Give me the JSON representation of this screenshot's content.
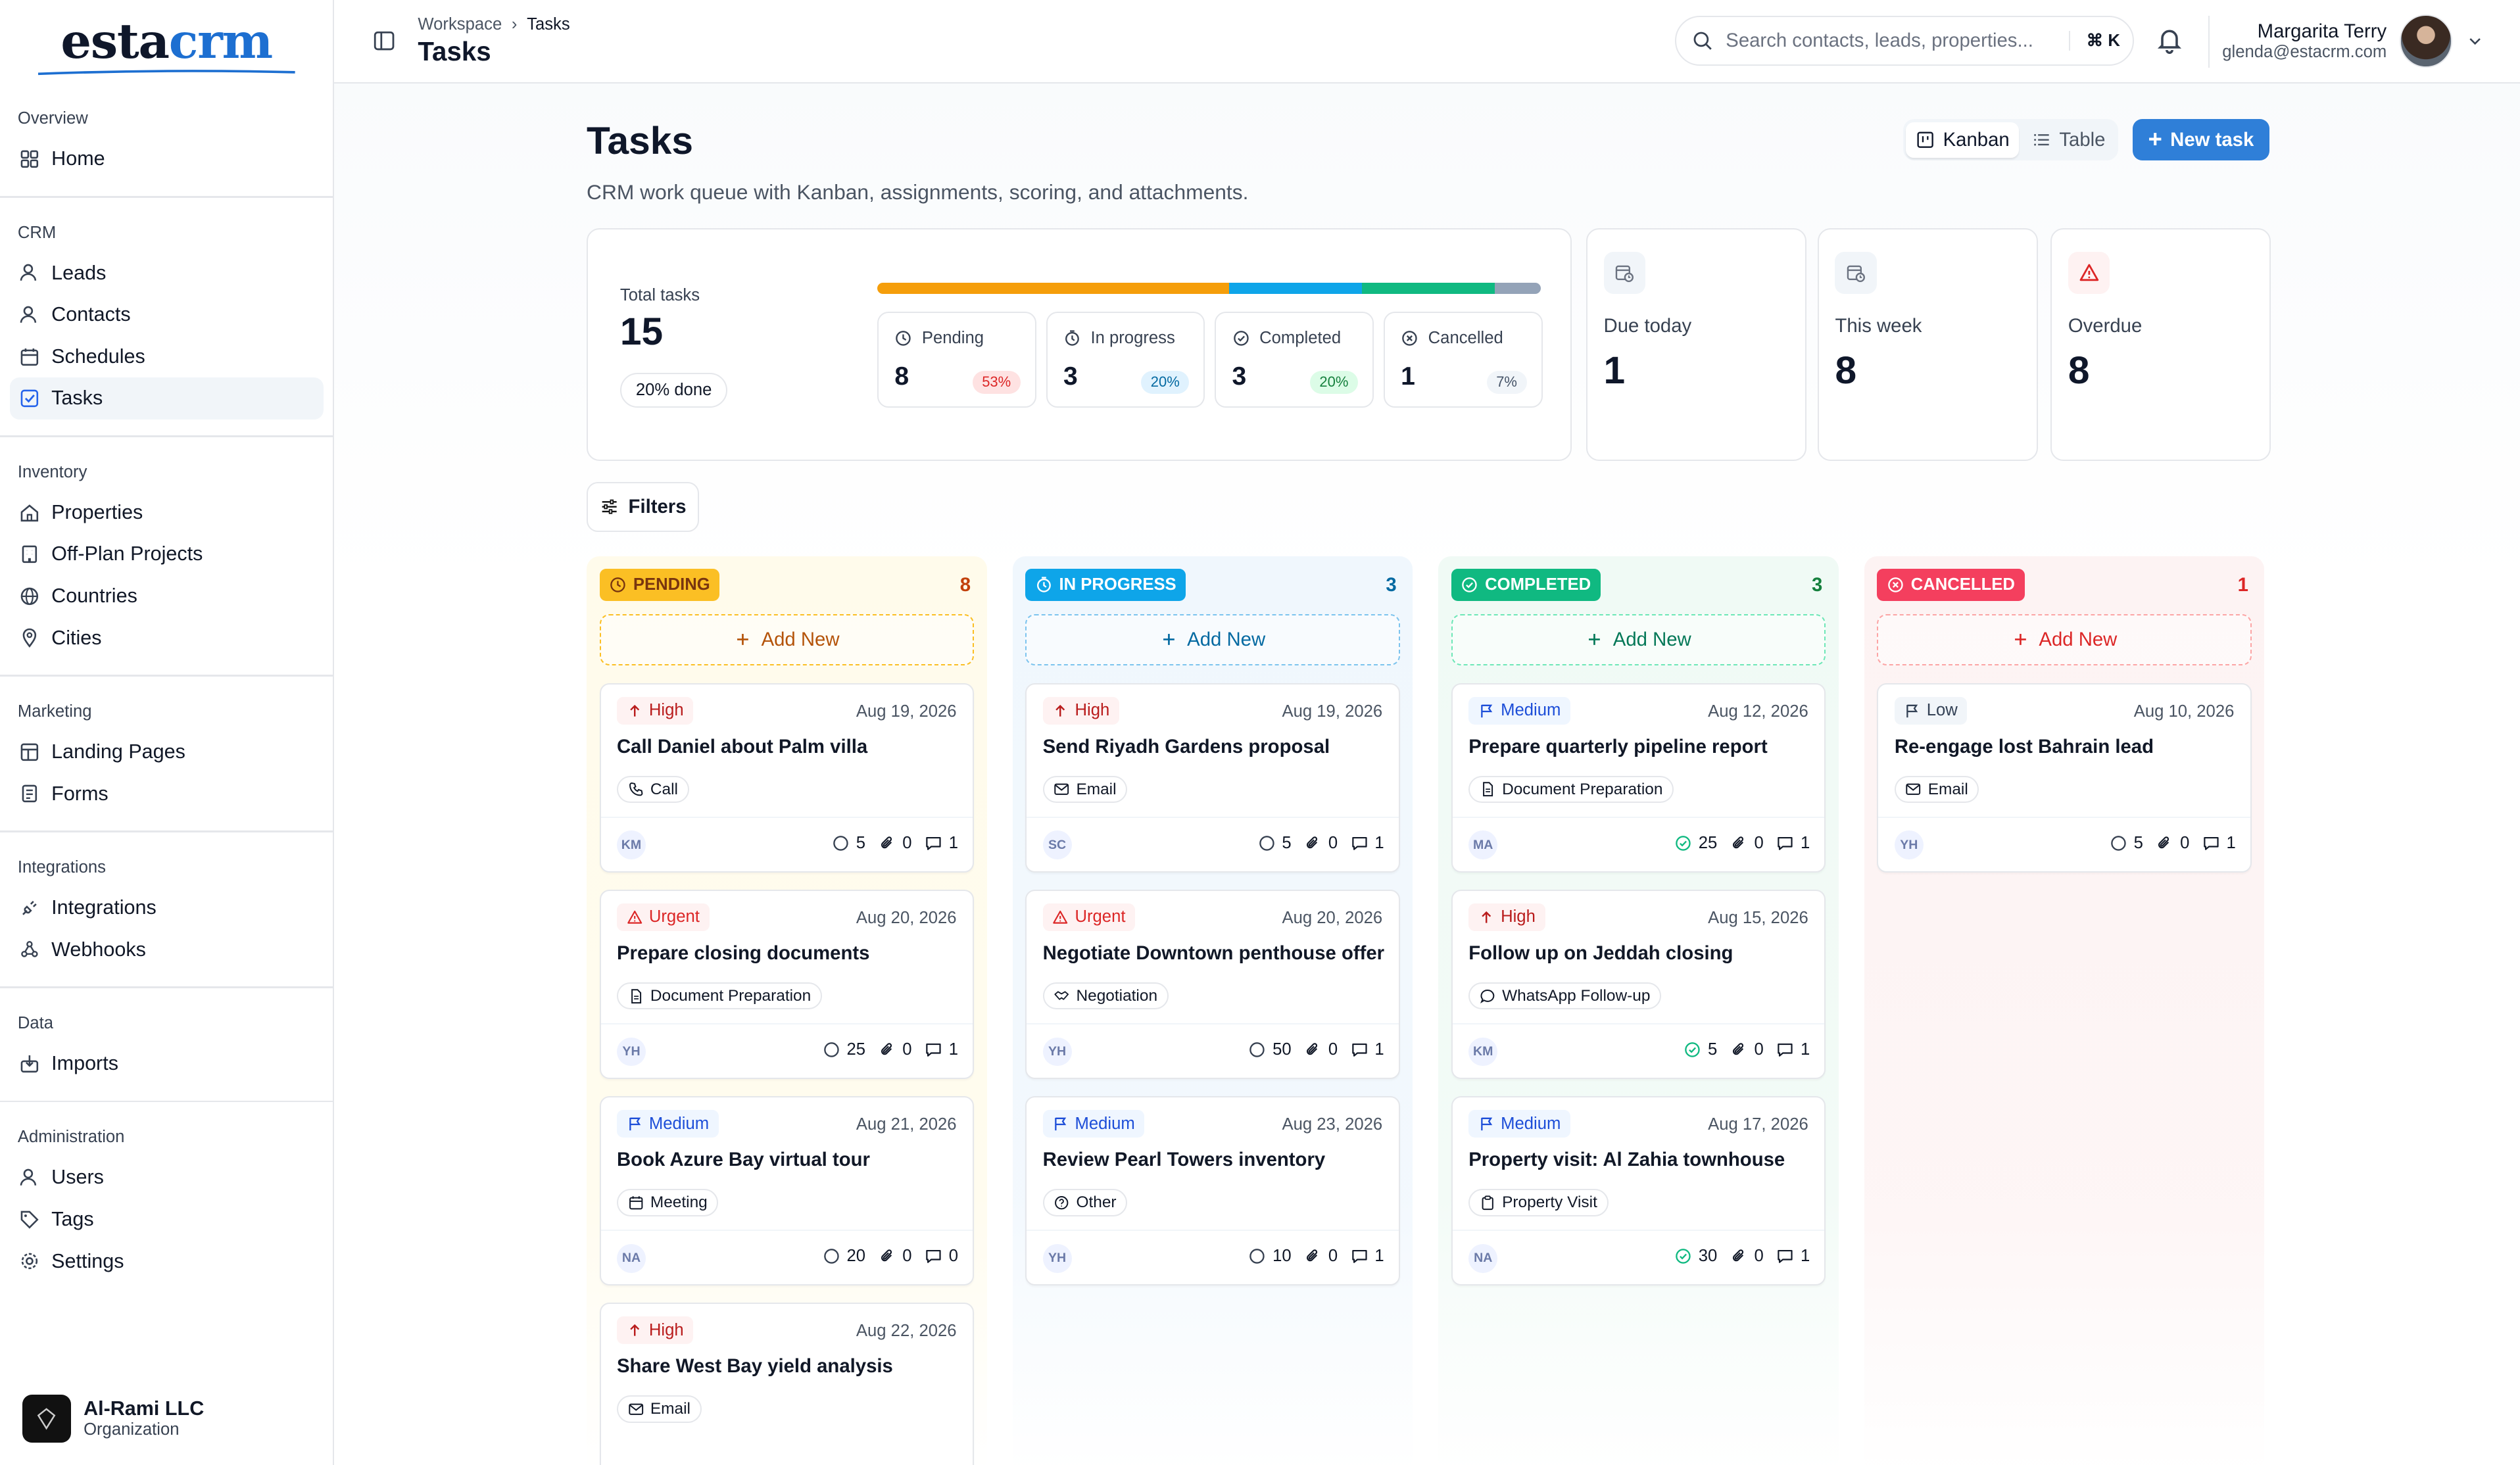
{
  "brand": {
    "part1": "esta",
    "part2": "crm"
  },
  "sidebar": {
    "groups": [
      {
        "label": "Overview",
        "items": [
          {
            "label": "Home",
            "icon": "grid-icon"
          }
        ]
      },
      {
        "label": "CRM",
        "items": [
          {
            "label": "Leads",
            "icon": "user-icon"
          },
          {
            "label": "Contacts",
            "icon": "user-icon"
          },
          {
            "label": "Schedules",
            "icon": "calendar-icon"
          },
          {
            "label": "Tasks",
            "icon": "checkbox-icon",
            "active": true
          }
        ]
      },
      {
        "label": "Inventory",
        "items": [
          {
            "label": "Properties",
            "icon": "home-icon"
          },
          {
            "label": "Off-Plan Projects",
            "icon": "building-icon"
          },
          {
            "label": "Countries",
            "icon": "globe-icon"
          },
          {
            "label": "Cities",
            "icon": "pin-icon"
          }
        ]
      },
      {
        "label": "Marketing",
        "items": [
          {
            "label": "Landing Pages",
            "icon": "layout-icon"
          },
          {
            "label": "Forms",
            "icon": "form-icon"
          }
        ]
      },
      {
        "label": "Integrations",
        "items": [
          {
            "label": "Integrations",
            "icon": "plug-icon"
          },
          {
            "label": "Webhooks",
            "icon": "webhook-icon"
          }
        ]
      },
      {
        "label": "Data",
        "items": [
          {
            "label": "Imports",
            "icon": "import-icon"
          }
        ]
      },
      {
        "label": "Administration",
        "items": [
          {
            "label": "Users",
            "icon": "user-icon"
          },
          {
            "label": "Tags",
            "icon": "tag-icon"
          },
          {
            "label": "Settings",
            "icon": "gear-icon"
          }
        ]
      }
    ],
    "org": {
      "name": "Al-Rami LLC",
      "type": "Organization"
    }
  },
  "topbar": {
    "breadcrumb": {
      "root": "Workspace",
      "current": "Tasks"
    },
    "title": "Tasks",
    "search_placeholder": "Search contacts, leads, properties...",
    "shortcut": "⌘ K",
    "user": {
      "name": "Margarita Terry",
      "email": "glenda@estacrm.com"
    }
  },
  "page": {
    "title": "Tasks",
    "subtitle": "CRM work queue with Kanban, assignments, scoring, and attachments.",
    "views": {
      "kanban": "Kanban",
      "table": "Table"
    },
    "new_task": "New task",
    "filters": "Filters"
  },
  "stats": {
    "total_label": "Total tasks",
    "total": "15",
    "done": "20% done",
    "progress_fractions": {
      "pending": 0.53,
      "in_progress": 0.2,
      "completed": 0.2,
      "cancelled": 0.07
    },
    "cells": [
      {
        "label": "Pending",
        "value": "8",
        "pct": "53%",
        "icon": "clock-icon",
        "color": "#f59e0b",
        "pct_bg": "#fee2e2",
        "pct_fg": "#dc2626"
      },
      {
        "label": "In progress",
        "value": "3",
        "pct": "20%",
        "icon": "timer-icon",
        "color": "#0ea5e9",
        "pct_bg": "#e0f2fe",
        "pct_fg": "#0369a1"
      },
      {
        "label": "Completed",
        "value": "3",
        "pct": "20%",
        "icon": "check-circle-icon",
        "color": "#10b981",
        "pct_bg": "#dcfce7",
        "pct_fg": "#15803d"
      },
      {
        "label": "Cancelled",
        "value": "1",
        "pct": "7%",
        "icon": "x-circle-icon",
        "color": "#94a3b8",
        "pct_bg": "#f1f5f9",
        "pct_fg": "#475569"
      }
    ],
    "cards": [
      {
        "label": "Due today",
        "value": "1",
        "icon": "calendar-clock-icon"
      },
      {
        "label": "This week",
        "value": "8",
        "icon": "calendar-clock-icon"
      },
      {
        "label": "Overdue",
        "value": "8",
        "icon": "alert-triangle-icon"
      }
    ]
  },
  "board": {
    "add_new": "Add New",
    "columns": [
      {
        "name": "PENDING",
        "count": "8",
        "badge_bg": "#fbbf24",
        "badge_fg": "#78350f",
        "count_color": "#c2410c",
        "col_bg": "#fffbeb",
        "dash": "#fbbf24",
        "add_color": "#b45309",
        "icon": "clock-icon",
        "cards": [
          {
            "priority": "High",
            "due": "Aug 19, 2026",
            "title": "Call Daniel about Palm villa",
            "type": "Call",
            "type_icon": "phone-icon",
            "initials": "KM",
            "score": "5",
            "attachments": "0",
            "comments": "1",
            "done": false
          },
          {
            "priority": "Urgent",
            "due": "Aug 20, 2026",
            "title": "Prepare closing documents",
            "type": "Document Preparation",
            "type_icon": "doc-icon",
            "initials": "YH",
            "score": "25",
            "attachments": "0",
            "comments": "1",
            "done": false
          },
          {
            "priority": "Medium",
            "due": "Aug 21, 2026",
            "title": "Book Azure Bay virtual tour",
            "type": "Meeting",
            "type_icon": "calendar-icon",
            "initials": "NA",
            "score": "20",
            "attachments": "0",
            "comments": "0",
            "done": false
          },
          {
            "priority": "High",
            "due": "Aug 22, 2026",
            "title": "Share West Bay yield analysis",
            "type": "Email",
            "type_icon": "mail-icon",
            "initials": "",
            "score": "",
            "attachments": "",
            "comments": "",
            "done": false
          }
        ]
      },
      {
        "name": "IN PROGRESS",
        "count": "3",
        "badge_bg": "#0ea5e9",
        "badge_fg": "#ffffff",
        "count_color": "#0369a1",
        "col_bg": "#f0f7fd",
        "dash": "#7dc4ee",
        "add_color": "#0369a1",
        "icon": "timer-icon",
        "cards": [
          {
            "priority": "High",
            "due": "Aug 19, 2026",
            "title": "Send Riyadh Gardens proposal",
            "type": "Email",
            "type_icon": "mail-icon",
            "initials": "SC",
            "score": "5",
            "attachments": "0",
            "comments": "1",
            "done": false
          },
          {
            "priority": "Urgent",
            "due": "Aug 20, 2026",
            "title": "Negotiate Downtown penthouse offer",
            "type": "Negotiation",
            "type_icon": "handshake-icon",
            "initials": "YH",
            "score": "50",
            "attachments": "0",
            "comments": "1",
            "done": false
          },
          {
            "priority": "Medium",
            "due": "Aug 23, 2026",
            "title": "Review Pearl Towers inventory",
            "type": "Other",
            "type_icon": "help-icon",
            "initials": "YH",
            "score": "10",
            "attachments": "0",
            "comments": "1",
            "done": false
          }
        ]
      },
      {
        "name": "COMPLETED",
        "count": "3",
        "badge_bg": "#10b981",
        "badge_fg": "#ffffff",
        "count_color": "#15803d",
        "col_bg": "#f0faf5",
        "dash": "#6ee7b7",
        "add_color": "#047857",
        "icon": "check-circle-icon",
        "cards": [
          {
            "priority": "Medium",
            "due": "Aug 12, 2026",
            "title": "Prepare quarterly pipeline report",
            "type": "Document Preparation",
            "type_icon": "doc-icon",
            "initials": "MA",
            "score": "25",
            "attachments": "0",
            "comments": "1",
            "done": true
          },
          {
            "priority": "High",
            "due": "Aug 15, 2026",
            "title": "Follow up on Jeddah closing",
            "type": "WhatsApp Follow-up",
            "type_icon": "chat-icon",
            "initials": "KM",
            "score": "5",
            "attachments": "0",
            "comments": "1",
            "done": true
          },
          {
            "priority": "Medium",
            "due": "Aug 17, 2026",
            "title": "Property visit: Al Zahia townhouse",
            "type": "Property Visit",
            "type_icon": "clipboard-icon",
            "initials": "NA",
            "score": "30",
            "attachments": "0",
            "comments": "1",
            "done": true
          }
        ]
      },
      {
        "name": "CANCELLED",
        "count": "1",
        "badge_bg": "#f43f5e",
        "badge_fg": "#ffffff",
        "count_color": "#dc2626",
        "col_bg": "#fdf3f3",
        "dash": "#fca5a5",
        "add_color": "#dc2626",
        "icon": "x-circle-icon",
        "cards": [
          {
            "priority": "Low",
            "due": "Aug 10, 2026",
            "title": "Re-engage lost Bahrain lead",
            "type": "Email",
            "type_icon": "mail-icon",
            "initials": "YH",
            "score": "5",
            "attachments": "0",
            "comments": "1",
            "done": false
          }
        ]
      }
    ]
  },
  "priority_styles": {
    "High": {
      "bg": "#fef2f2",
      "fg": "#b91c1c",
      "icon": "arrow-up-icon"
    },
    "Urgent": {
      "bg": "#fef2f2",
      "fg": "#dc2626",
      "icon": "alert-triangle-icon"
    },
    "Medium": {
      "bg": "#eff6ff",
      "fg": "#1d4ed8",
      "icon": "flag-icon"
    },
    "Low": {
      "bg": "#f1f5f9",
      "fg": "#334155",
      "icon": "flag-icon"
    }
  }
}
